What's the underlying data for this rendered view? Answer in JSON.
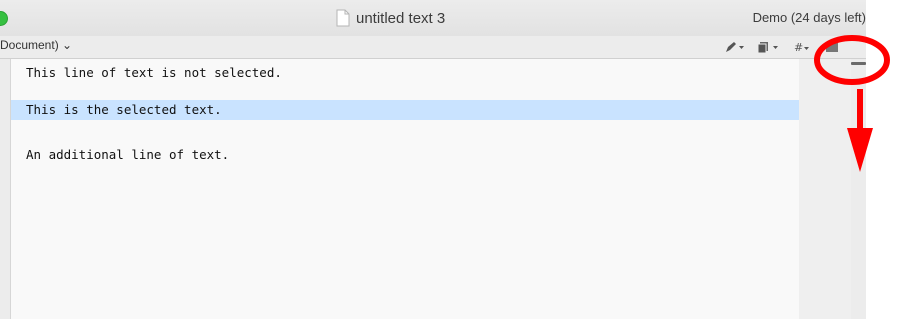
{
  "window": {
    "title": "untitled text 3",
    "status": "Demo (24 days left)"
  },
  "toolbar": {
    "document_popup": "Document) ⌄",
    "icons": [
      "pen-icon",
      "document-icon",
      "hash-icon",
      "popup-icon"
    ]
  },
  "editor": {
    "lines": [
      {
        "text": "This line of text is not selected.",
        "selected": false
      },
      {
        "text": "This is the selected text.",
        "selected": true
      },
      {
        "text": "An additional line of text.",
        "selected": false
      }
    ],
    "selection_color": "#c9e3ff"
  },
  "annotation": {
    "color": "#ff0000",
    "shapes": [
      "circle-highlight",
      "down-arrow"
    ]
  }
}
